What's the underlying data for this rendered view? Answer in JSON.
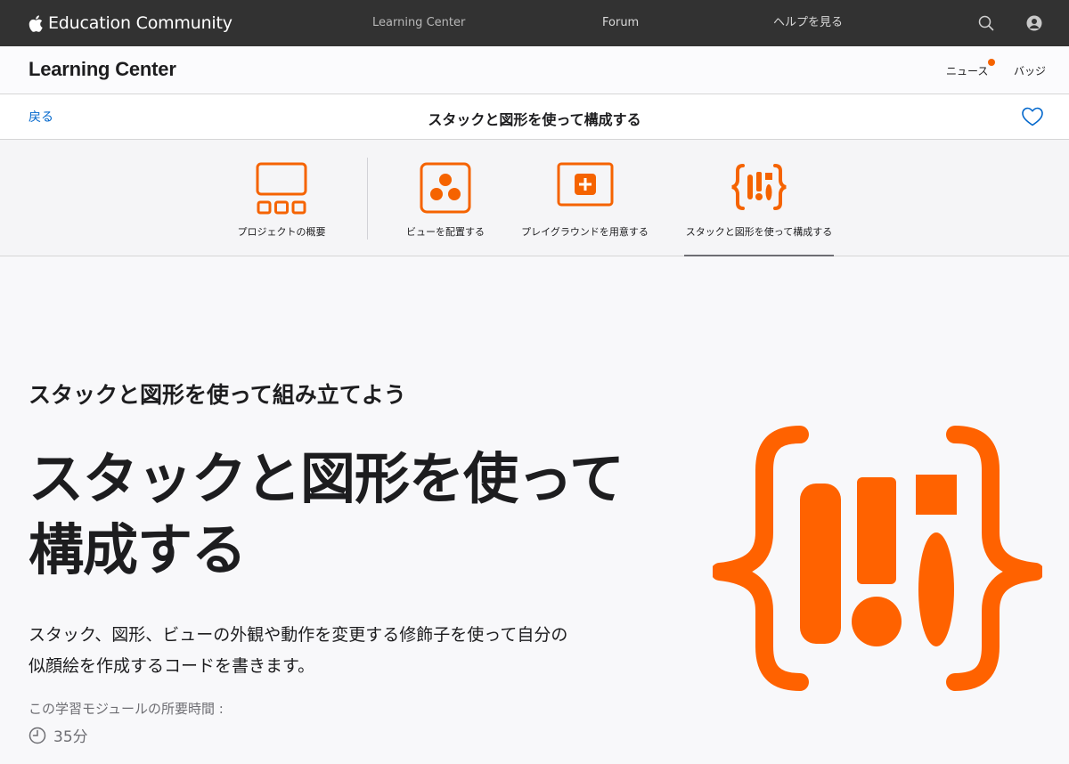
{
  "global_nav": {
    "brand": "Education Community",
    "links": [
      "Learning Center",
      "Forum",
      "ヘルプを見る"
    ],
    "icons": [
      "apple-logo-icon",
      "search-icon",
      "user-account-icon"
    ]
  },
  "section_header": {
    "title": "Learning Center",
    "news": "ニュース",
    "badges": "バッジ",
    "accent": "#f56300"
  },
  "subnav": {
    "back": "戻る",
    "title": "スタックと図形を使って構成する",
    "favorite_icon": "heart-icon"
  },
  "tabs": [
    {
      "label": "プロジェクトの概要",
      "icon": "project-overview-icon"
    },
    {
      "label": "ビューを配置する",
      "icon": "arrange-views-icon"
    },
    {
      "label": "プレイグラウンドを用意する",
      "icon": "playground-icon"
    },
    {
      "label": "スタックと図形を使って構成する",
      "icon": "stacks-shapes-icon",
      "active": true
    }
  ],
  "hero": {
    "eyebrow": "スタックと図形を使って組み立てよう",
    "title_line1": "スタックと図形を使って",
    "title_line2": "構成する",
    "description_line1": "スタック、図形、ビューの外観や動作を変更する修飾子を使って自分の",
    "description_line2": "似顔絵を作成するコードを書きます。",
    "duration_label": "この学習モジュールの所要時間 :",
    "duration": "35分",
    "icon": "stacks-shapes-icon"
  },
  "colors": {
    "accent": "#f56300",
    "link": "#0066cc",
    "nav_bg": "#323232"
  }
}
